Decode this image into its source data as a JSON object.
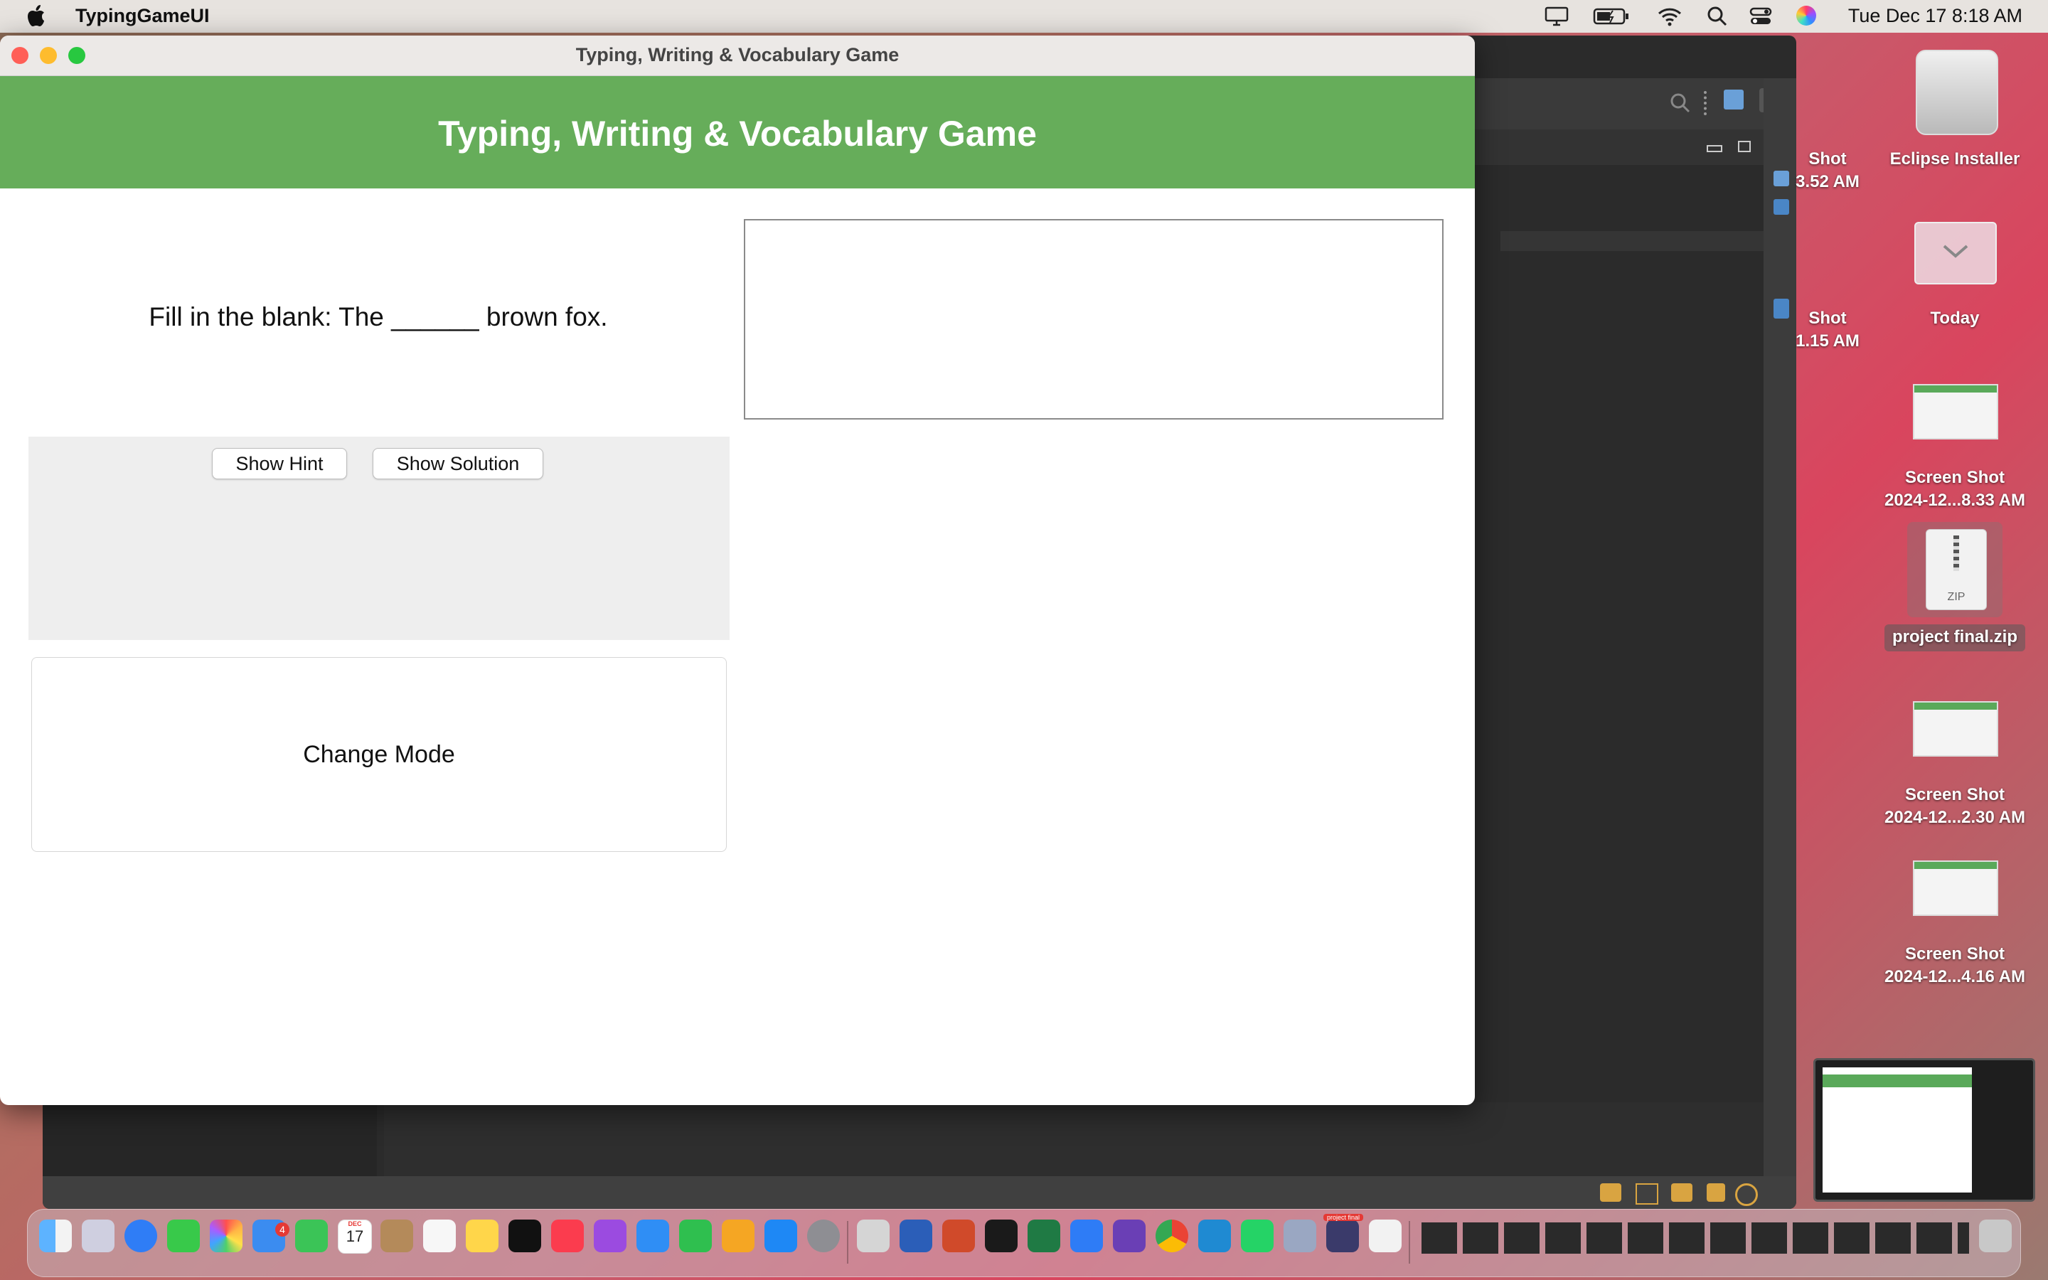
{
  "menubar": {
    "app_name": "TypingGameUI",
    "clock": "Tue Dec 17  8:18 AM"
  },
  "desktop": {
    "items": [
      {
        "label_line1": "Eclipse Installer",
        "label_line2": ""
      },
      {
        "label_line1": "Today",
        "label_line2": ""
      },
      {
        "label_line1": "Screen Shot",
        "label_line2": "2024-12...8.33 AM"
      },
      {
        "label_line1": "project final.zip",
        "label_line2": ""
      },
      {
        "label_line1": "Screen Shot",
        "label_line2": "2024-12...2.30 AM"
      },
      {
        "label_line1": "Screen Shot",
        "label_line2": "2024-12...4.16 AM"
      }
    ],
    "partial_left": [
      {
        "label_line1": "Shot",
        "label_line2": "3.52 AM"
      },
      {
        "label_line1": "Shot",
        "label_line2": "1.15 AM"
      }
    ],
    "zip_text": "ZIP"
  },
  "window": {
    "title": "Typing, Writing & Vocabulary Game",
    "header_title": "Typing, Writing & Vocabulary Game",
    "question": "Fill in the blank: The ______ brown fox.",
    "answer_value": "",
    "show_hint_label": "Show Hint",
    "show_solution_label": "Show Solution",
    "change_mode_label": "Change Mode"
  },
  "dock": {
    "mail_badge": "4",
    "calendar_month": "DEC",
    "calendar_day": "17",
    "project_label": "project final"
  },
  "colors": {
    "header_green": "#66ad5a",
    "close": "#ff5f57",
    "minimize": "#febc2e",
    "zoom": "#28c840"
  }
}
